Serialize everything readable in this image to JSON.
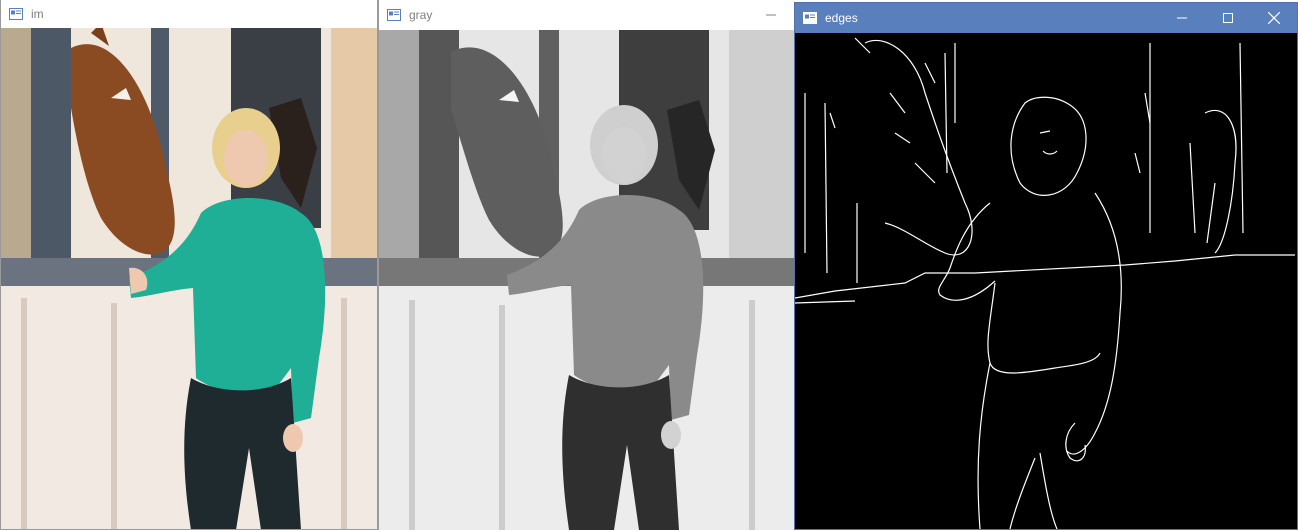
{
  "windows": {
    "im": {
      "title": "im"
    },
    "gray": {
      "title": "gray",
      "controls": [
        "minimize"
      ]
    },
    "edges": {
      "title": "edges",
      "controls": [
        "minimize",
        "maximize",
        "close"
      ]
    }
  },
  "colors": {
    "active_titlebar": "#5a7fbd",
    "inactive_titlebar": "#ffffff",
    "shirt": "#1fae96",
    "horse": "#8a4b22",
    "edges_bg": "#000000",
    "edges_stroke": "#ffffff"
  },
  "icons": {
    "window": "app-window-icon",
    "minimize": "minimize-icon",
    "maximize": "maximize-icon",
    "close": "close-icon"
  }
}
